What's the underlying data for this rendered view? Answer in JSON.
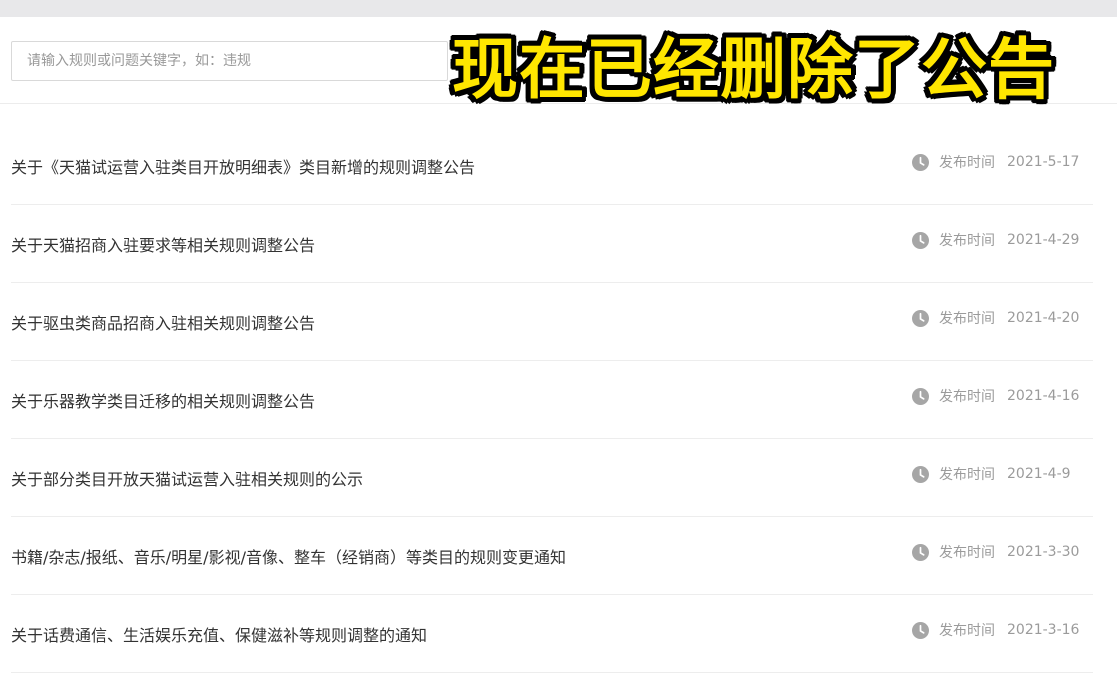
{
  "search": {
    "placeholder": "请输入规则或问题关键字，如：违规",
    "value": ""
  },
  "overlay": {
    "caption": "现在已经删除了公告"
  },
  "list": {
    "time_label": "发布时间",
    "icon": "clock-icon",
    "items": [
      {
        "title": "关于《天猫试运营入驻类目开放明细表》类目新增的规则调整公告",
        "date": "2021-5-17"
      },
      {
        "title": "关于天猫招商入驻要求等相关规则调整公告",
        "date": "2021-4-29"
      },
      {
        "title": "关于驱虫类商品招商入驻相关规则调整公告",
        "date": "2021-4-20"
      },
      {
        "title": "关于乐器教学类目迁移的相关规则调整公告",
        "date": "2021-4-16"
      },
      {
        "title": "关于部分类目开放天猫试运营入驻相关规则的公示",
        "date": "2021-4-9"
      },
      {
        "title": "书籍/杂志/报纸、音乐/明星/影视/音像、整车（经销商）等类目的规则变更通知",
        "date": "2021-3-30"
      },
      {
        "title": "关于话费通信、生活娱乐充值、保健滋补等规则调整的通知",
        "date": "2021-3-16"
      }
    ]
  }
}
